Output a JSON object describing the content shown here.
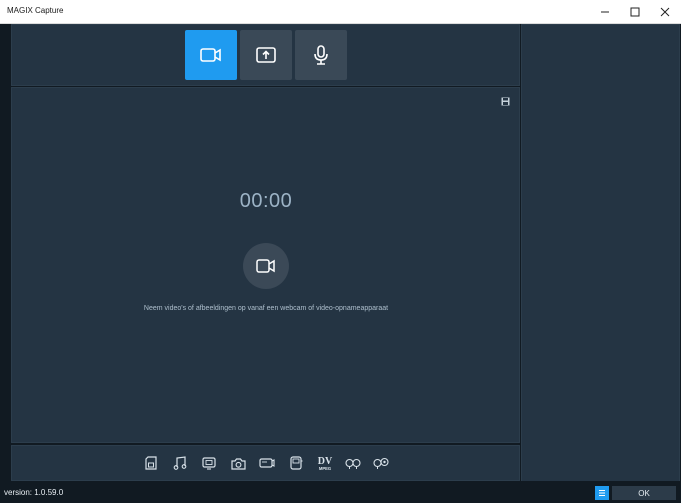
{
  "window": {
    "title": "MAGIX Capture",
    "minimize_glyph": "—",
    "maximize_glyph": "☐",
    "close_glyph": "✕"
  },
  "modes": [
    {
      "name": "video-capture",
      "icon": "camera-icon",
      "active": true
    },
    {
      "name": "screen-capture",
      "icon": "upload-screen-icon",
      "active": false
    },
    {
      "name": "audio-capture",
      "icon": "microphone-icon",
      "active": false
    }
  ],
  "preview": {
    "timer": "00:00",
    "hint": "Neem video's of afbeeldingen op vanaf een webcam of video-opnameapparaat"
  },
  "formats": [
    "sd-card-icon",
    "music-note-icon",
    "monitor-icon",
    "photo-camera-icon",
    "camcorder-icon",
    "device-icon",
    "dv-mpeg-icon",
    "cassette-icon",
    "cassette-settings-icon"
  ],
  "dv_icon_label": {
    "top": "DV",
    "bottom": "MPEG"
  },
  "status": {
    "version": "version: 1.0.59.0",
    "ok_label": "OK"
  },
  "colors": {
    "accent": "#1f9bf0",
    "panel": "#243443",
    "background": "#111a22"
  }
}
